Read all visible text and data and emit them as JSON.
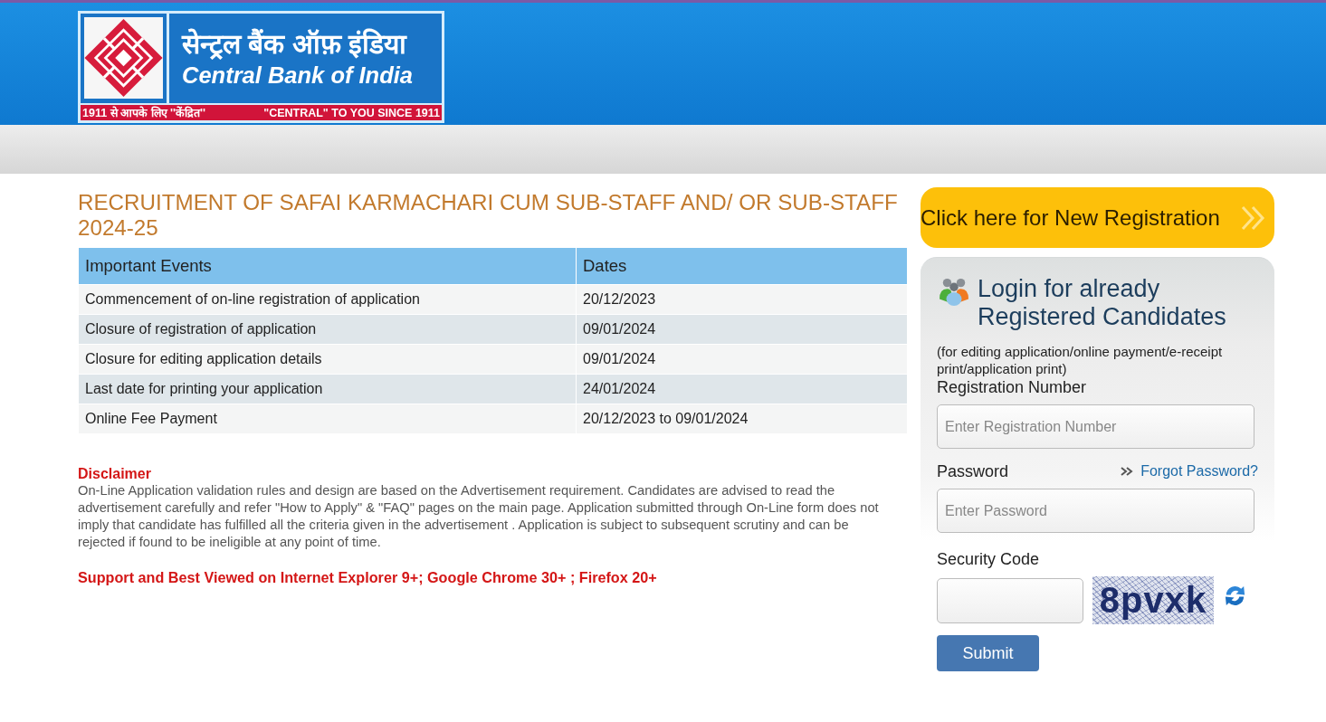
{
  "header": {
    "logo": {
      "hindi_name": "सेन्ट्रल बैंक ऑफ़ इंडिया",
      "english_name": "Central Bank of India",
      "tagline_hindi": "1911 से आपके लिए ''केंद्रित''",
      "tagline_english": "\"CENTRAL\" TO YOU SINCE 1911"
    }
  },
  "main": {
    "title": "RECRUITMENT OF SAFAI KARMACHARI CUM SUB-STAFF AND/ OR SUB-STAFF 2024-25",
    "events_table": {
      "columns": [
        "Important Events",
        "Dates"
      ],
      "rows": [
        [
          "Commencement of on-line registration of application",
          "20/12/2023"
        ],
        [
          "Closure of registration of application",
          "09/01/2024"
        ],
        [
          "Closure for editing application details",
          "09/01/2024"
        ],
        [
          "Last date for printing your application",
          "24/01/2024"
        ],
        [
          "Online Fee Payment",
          "20/12/2023 to 09/01/2024"
        ]
      ]
    },
    "disclaimer": {
      "heading": "Disclaimer",
      "text": "On-Line Application validation rules and design are based on the Advertisement requirement. Candidates are advised to read the advertisement carefully and refer \"How to Apply\" & \"FAQ\" pages on the main page. Application submitted through On-Line form does not imply that candidate has fulfilled all the criteria given in the advertisement . Application is subject to subsequent scrutiny and can be rejected if found to be ineligible at any point of time."
    },
    "browser_support": "Support and Best Viewed on Internet Explorer 9+; Google Chrome 30+ ; Firefox 20+"
  },
  "sidebar": {
    "new_registration_button": "Click here for New Registration",
    "login": {
      "title": "Login for already Registered Candidates",
      "note": "(for editing application/online payment/e-receipt print/application print)",
      "registration_number": {
        "label": "Registration Number",
        "placeholder": "Enter Registration Number"
      },
      "password": {
        "label": "Password",
        "placeholder": "Enter Password"
      },
      "forgot_password_link": "Forgot Password?",
      "security_code": {
        "label": "Security Code"
      },
      "captcha": "8pvxk",
      "submit_button": "Submit"
    }
  }
}
